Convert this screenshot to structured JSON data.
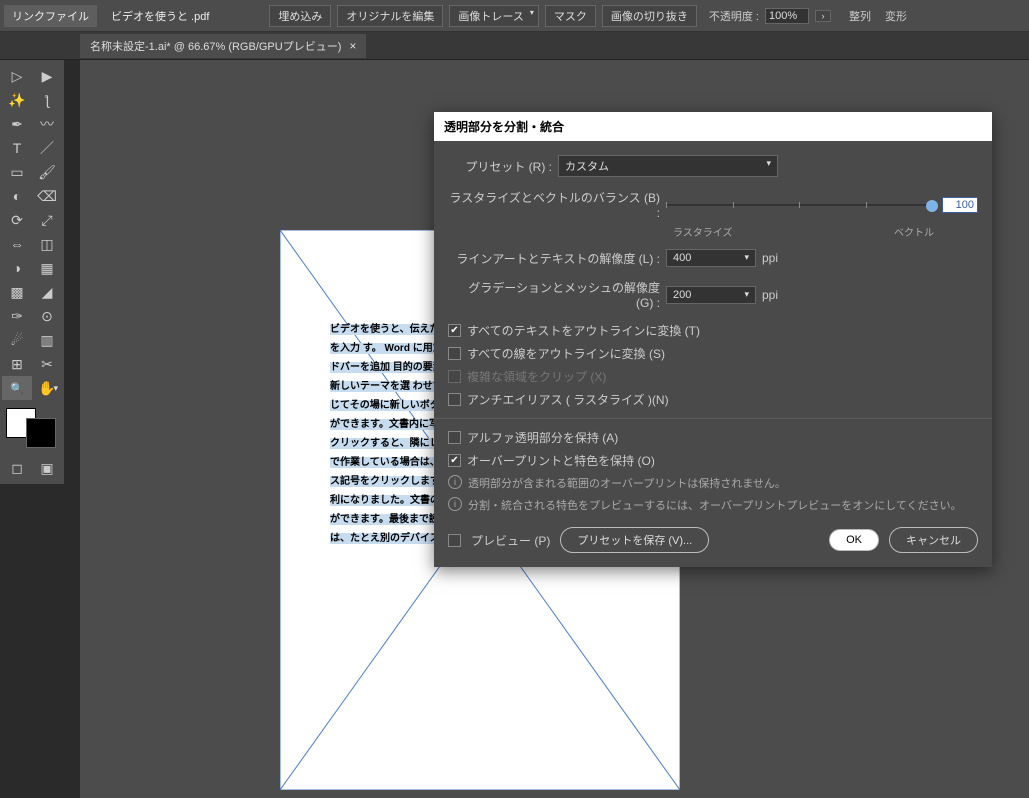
{
  "topbar": {
    "link_label": "リンクファイル",
    "file_name": "ビデオを使うと .pdf",
    "btn_embed": "埋め込み",
    "btn_edit_orig": "オリジナルを編集",
    "btn_trace": "画像トレース",
    "btn_mask": "マスク",
    "btn_crop": "画像の切り抜き",
    "opacity_label": "不透明度 :",
    "opacity_value": "100%",
    "btn_align": "整列",
    "btn_transform": "変形"
  },
  "tab": {
    "title": "名称未設定-1.ai* @ 66.67% (RGB/GPUプレビュー)"
  },
  "document_text": "ビデオを使うと、伝えたい\nると、追加したいビデオを\nります。キーワードを入力\nす。\nWord に用意されている\n合わせると、プロのような\nダー、サイドバーを追加\n目的の要素を選んでくださ\nテーマとスタイルを使って\nックし新しいテーマを選\nわせて変わります。スタ\nれます。\nWord では、必要に応じてその場に新しいボタンが表示されるため、効率良く操作を進めることができます。文書内に写真をレイアウトする方法を変更するには、写真をクリックすると、隣にレイアウト オプションのボタンが表示されます。表で作業している場合は、行または列を追加する場所をクリックして、プラス記号をクリックします。\n新しい閲覧ビューが導入され、閲覧もさらに便利になりました。文書の一部を折りたたんで、必要な箇所に集中することができます。最後まで読み終わる前に中止する必要がある場合、Word では、たとえ別のデバイスであっても、どこまで読んだかが記憶されます。",
  "dialog": {
    "title": "透明部分を分割・統合",
    "preset_label": "プリセット (R) :",
    "preset_value": "カスタム",
    "balance_label": "ラスタライズとベクトルのバランス (B) :",
    "balance_value": "100",
    "balance_left": "ラスタライズ",
    "balance_right": "ベクトル",
    "lineart_label": "ラインアートとテキストの解像度 (L) :",
    "lineart_value": "400",
    "gradient_label": "グラデーションとメッシュの解像度 (G) :",
    "gradient_value": "200",
    "ppi": "ppi",
    "chk_text_outline": "すべてのテキストをアウトラインに変換 (T)",
    "chk_stroke_outline": "すべての線をアウトラインに変換 (S)",
    "chk_clip": "複雑な領域をクリップ (X)",
    "chk_antialias": "アンチエイリアス ( ラスタライズ )(N)",
    "chk_alpha": "アルファ透明部分を保持 (A)",
    "chk_overprint": "オーバープリントと特色を保持 (O)",
    "info1": "透明部分が含まれる範囲のオーバープリントは保持されません。",
    "info2": "分割・統合される特色をプレビューするには、オーバープリントプレビューをオンにしてください。",
    "chk_preview": "プレビュー (P)",
    "btn_save_preset": "プリセットを保存 (V)...",
    "btn_ok": "OK",
    "btn_cancel": "キャンセル"
  }
}
